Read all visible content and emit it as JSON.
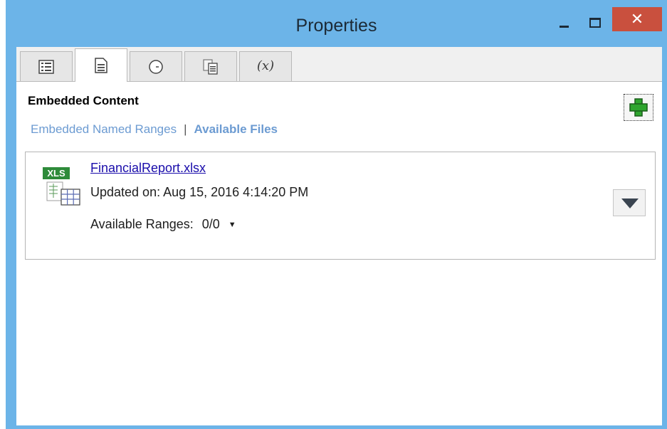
{
  "window": {
    "title": "Properties",
    "close_glyph": "✕"
  },
  "tabs": [
    {
      "name": "list-tab",
      "icon": "list-icon",
      "active": false
    },
    {
      "name": "document-tab",
      "icon": "document-icon",
      "active": true
    },
    {
      "name": "clock-tab",
      "icon": "clock-icon",
      "active": false
    },
    {
      "name": "copy-tab",
      "icon": "copy-document-icon",
      "active": false
    },
    {
      "name": "variable-tab",
      "icon": "variable-icon",
      "label": "(x)",
      "active": false
    }
  ],
  "content": {
    "section_title": "Embedded Content",
    "links": {
      "named_ranges": "Embedded Named Ranges",
      "separator": "|",
      "available_files": "Available Files"
    },
    "add_button_icon": "green-plus-icon"
  },
  "file": {
    "icon": "excel-file-icon",
    "icon_label": "XLS",
    "name": "FinancialReport.xlsx",
    "updated": "Updated on: Aug 15, 2016 4:14:20 PM",
    "ranges_label": "Available Ranges:",
    "ranges_value": "0/0",
    "ranges_caret": "▼",
    "expand_icon": "chevron-down-icon"
  },
  "colors": {
    "titlebar": "#6cb4e8",
    "close_button": "#c9503e",
    "link": "#6c9bd2",
    "file_link": "#1a0dab",
    "add_icon": "#2ea52e"
  }
}
